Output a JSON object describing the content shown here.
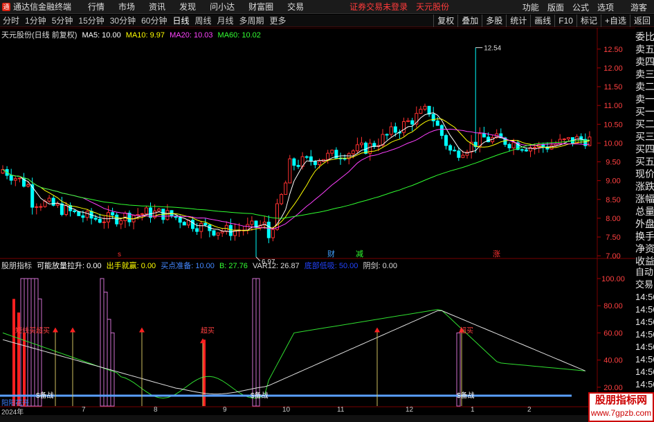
{
  "topbar": {
    "logo": "通",
    "app_title": "通达信金融终端",
    "menu": [
      "行情",
      "市场",
      "资讯",
      "发现",
      "问小达",
      "财富圈",
      "交易"
    ],
    "warn1": "证券交易未登录",
    "warn2": "天元股份",
    "right": [
      "功能",
      "版面",
      "公式",
      "选项"
    ],
    "user": "游客"
  },
  "periods": {
    "items": [
      "分时",
      "1分钟",
      "5分钟",
      "15分钟",
      "30分钟",
      "60分钟",
      "日线",
      "周线",
      "月线",
      "多周期",
      "更多"
    ],
    "active": "日线",
    "right": [
      "复权",
      "叠加",
      "多股",
      "统计",
      "画线",
      "F10",
      "标记",
      "+自选",
      "返回"
    ]
  },
  "price_title": {
    "name": "天元股份(日线 前复权)",
    "ma5": "MA5: 10.00",
    "ma10": "MA10: 9.97",
    "ma20": "MA20: 10.03",
    "ma60": "MA60: 10.02"
  },
  "colors": {
    "ma5": "#ffffff",
    "ma10": "#ffff00",
    "ma20": "#ff40ff",
    "ma60": "#30ff30",
    "up": "#ff3030",
    "down": "#00ffff",
    "accent": "#ff3030"
  },
  "price_axis": {
    "labels": [
      "12.50",
      "12.00",
      "11.50",
      "11.00",
      "10.50",
      "10.00",
      "9.50",
      "9.00",
      "8.50",
      "8.00",
      "7.50",
      "7.00"
    ]
  },
  "annotations": {
    "high": "12.54",
    "low": "6.97"
  },
  "markers": {
    "s": "s",
    "cai": "财",
    "jian": "减",
    "zhang": "涨"
  },
  "indicator_title": {
    "name": "股朋指标",
    "f1": "可能放量拉升: 0.00",
    "f2": "出手就赢: 0.00",
    "f3": "买点准备: 10.00",
    "f4": "B: 27.76",
    "f5": "VAR12: 26.87",
    "f6": "底部低吸: 50.00",
    "f7": "阴剑: 0.00"
  },
  "ind_axis": {
    "labels": [
      "100.00",
      "80.00",
      "60.00",
      "40.00",
      "20.00"
    ]
  },
  "ind_labels": {
    "buy1": "短线买",
    "buy2": "超买",
    "buy3": "超买",
    "buy4": "超买",
    "prep1": "$备战",
    "prep2": "$备战",
    "prep3": "$备战",
    "bottom": "阳阳花开"
  },
  "sidebar": [
    "委比",
    "卖五",
    "卖四",
    "卖三",
    "卖二",
    "卖一",
    "买一",
    "买二",
    "买三",
    "买四",
    "买五",
    "现价",
    "涨跌",
    "涨幅",
    "总量",
    "外盘",
    "换手",
    "净资",
    "收益"
  ],
  "sidebar2": [
    "自动",
    "交易",
    "14:56",
    "14:56",
    "14:56",
    "14:56",
    "14:56",
    "14:56",
    "14:56",
    "14:56",
    "14:56"
  ],
  "dates": [
    "2024年",
    "7",
    "8",
    "9",
    "10",
    "11",
    "12",
    "1",
    "2"
  ],
  "watermark": {
    "title": "股朋指标网",
    "url": "www.7gpzb.com"
  },
  "chart_data": {
    "type": "candlestick",
    "ylim": [
      6.8,
      12.7
    ],
    "stats": {
      "high": 12.54,
      "low": 6.97
    },
    "ma": {
      "MA5": 10.0,
      "MA10": 9.97,
      "MA20": 10.03,
      "MA60": 10.02
    }
  }
}
